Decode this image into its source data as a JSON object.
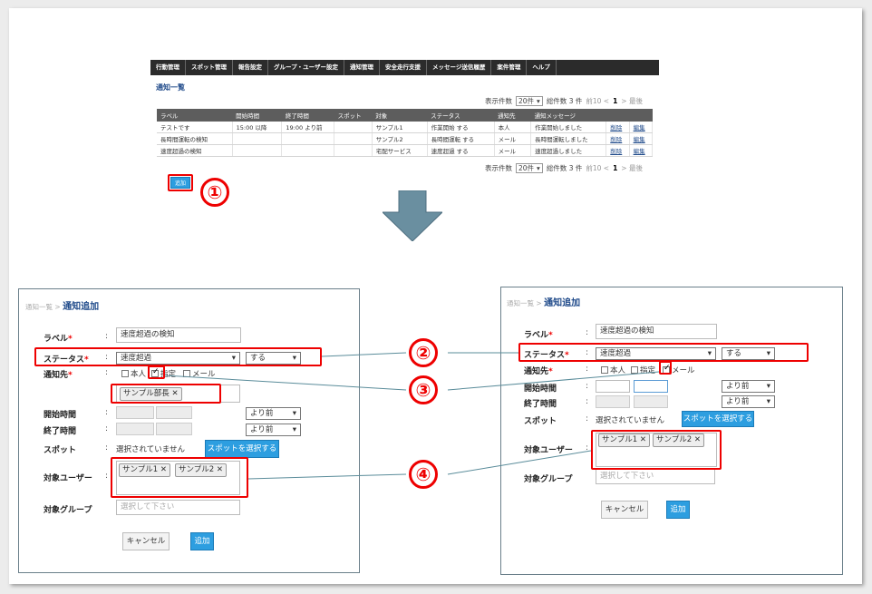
{
  "nav": [
    "行動管理",
    "スポット管理",
    "報告設定",
    "グループ・ユーザー設定",
    "通知管理",
    "安全走行支援",
    "メッセージ送信履歴",
    "案件管理",
    "ヘルプ"
  ],
  "list": {
    "title": "通知一覧",
    "per_page_label": "表示件数",
    "per_page_value": "20件",
    "total": "総件数 3 件",
    "prev": "前10 <",
    "page": "1",
    "next": "> 最後",
    "columns": [
      "ラベル",
      "開始時間",
      "終了時間",
      "スポット",
      "対象",
      "ステータス",
      "通知先",
      "通知メッセージ",
      "",
      ""
    ],
    "rows": [
      [
        "テストです",
        "15:00 以降",
        "19:00 より前",
        "",
        "サンプル1",
        "作業開始 する",
        "本人",
        "作業開始しました",
        "削除",
        "編集"
      ],
      [
        "長時間運転の検知",
        "",
        "",
        "",
        "サンプル2",
        "長時間運転 する",
        "メール",
        "長時間運転しました",
        "削除",
        "編集"
      ],
      [
        "速度超過の検知",
        "",
        "",
        "",
        "宅配サービス",
        "速度超過 する",
        "メール",
        "速度超過しました",
        "削除",
        "編集"
      ]
    ],
    "add_button": "追加"
  },
  "markers": [
    "①",
    "②",
    "③",
    "④"
  ],
  "left_form": {
    "breadcrumb_link": "通知一覧",
    "breadcrumb_sep": ">",
    "breadcrumb_current": "通知追加",
    "label_label": "ラベル",
    "label_value": "速度超過の検知",
    "status_label": "ステータス",
    "status_value": "速度超過",
    "status_action": "する",
    "notify_label": "通知先",
    "notify_self": "本人",
    "notify_specified": "指定",
    "notify_mail": "メール",
    "notify_tag": "サンプル部長",
    "start_label": "開始時間",
    "start_rel": "より前",
    "end_label": "終了時間",
    "end_rel": "より前",
    "spot_label": "スポット",
    "spot_value": "選択されていません",
    "spot_button": "スポットを選択する",
    "users_label": "対象ユーザー",
    "user_tags": [
      "サンプル1",
      "サンプル2"
    ],
    "group_label": "対象グループ",
    "group_placeholder": "選択して下さい",
    "cancel": "キャンセル",
    "add": "追加"
  },
  "right_form": {
    "breadcrumb_link": "通知一覧",
    "breadcrumb_sep": ">",
    "breadcrumb_current": "通知追加",
    "label_label": "ラベル",
    "label_value": "速度超過の検知",
    "status_label": "ステータス",
    "status_value": "速度超過",
    "status_action": "する",
    "notify_label": "通知先",
    "notify_self": "本人",
    "notify_specified": "指定",
    "notify_mail": "メール",
    "start_label": "開始時間",
    "start_rel": "より前",
    "end_label": "終了時間",
    "end_rel": "より前",
    "spot_label": "スポット",
    "spot_value": "選択されていません",
    "spot_button": "スポットを選択する",
    "users_label": "対象ユーザー",
    "user_tags": [
      "サンプル1",
      "サンプル2"
    ],
    "group_label": "対象グループ",
    "group_placeholder": "選択して下さい",
    "cancel": "キャンセル",
    "add": "追加"
  },
  "colors": {
    "accent": "#2d9ee0",
    "highlight": "#ee0000",
    "arrow": "#6a8fa0",
    "nav_bg": "#2b2b2b"
  }
}
